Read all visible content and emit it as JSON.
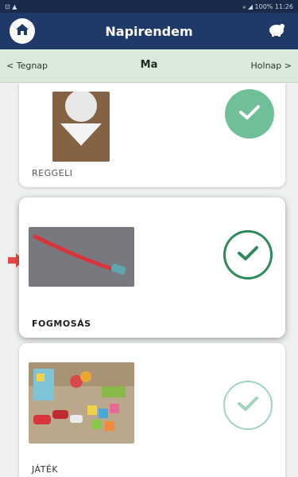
{
  "status": {
    "left": "⊡ ▲",
    "right": "⁎ ◢ 100% 11:26"
  },
  "app": {
    "title": "Napirendem"
  },
  "day_nav": {
    "prev": "< Tegnap",
    "current": "Ma",
    "next": "Holnap >"
  },
  "colors": {
    "app_bar": "#1f3a68",
    "nav_bg": "#d9eadc",
    "check_done": "#6fbf98",
    "check_active": "#2e8a5c",
    "check_pending": "#9fd5bb",
    "pointer": "#e84848"
  },
  "activities": [
    {
      "label": "REGGELI",
      "state": "done",
      "icon": "check-icon"
    },
    {
      "label": "FOGMOSÁS",
      "state": "active",
      "icon": "check-icon"
    },
    {
      "label": "JÁTÉK",
      "state": "pending",
      "icon": "check-icon"
    }
  ]
}
